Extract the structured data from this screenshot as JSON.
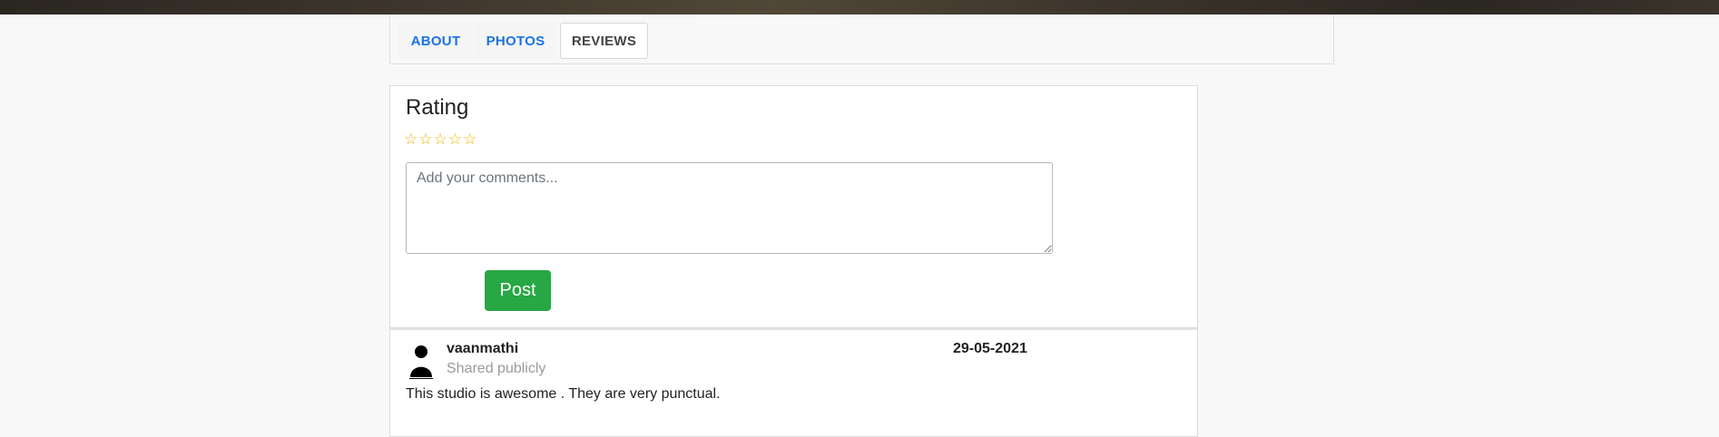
{
  "tabs": [
    {
      "label": "ABOUT"
    },
    {
      "label": "PHOTOS"
    },
    {
      "label": "REVIEWS"
    }
  ],
  "active_tab": "REVIEWS",
  "rating": {
    "title": "Rating",
    "stars": [
      "☆",
      "☆",
      "☆",
      "☆",
      "☆"
    ],
    "selected_stars": 0,
    "comment_placeholder": "Add your comments...",
    "comment_value": "",
    "post_label": "Post"
  },
  "reviews": [
    {
      "name": "vaanmathi",
      "visibility": "Shared publicly",
      "date": "29-05-2021",
      "text": "This studio is awesome . They are very punctual."
    }
  ],
  "colors": {
    "tab_link": "#1a73e8",
    "post_button": "#28a745",
    "star": "#f0b400"
  },
  "icons": {
    "avatar": "user-silhouette-icon"
  }
}
